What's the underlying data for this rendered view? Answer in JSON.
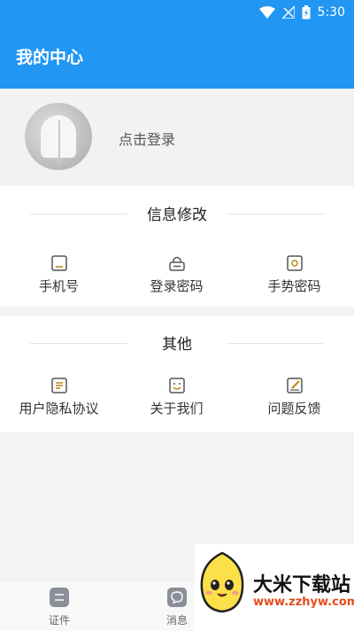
{
  "status_bar": {
    "time": "5:30"
  },
  "header": {
    "title": "我的中心"
  },
  "profile": {
    "login_label": "点击登录"
  },
  "sections": [
    {
      "title": "信息修改",
      "items": [
        {
          "label": "手机号",
          "icon": "phone-icon"
        },
        {
          "label": "登录密码",
          "icon": "lock-icon"
        },
        {
          "label": "手势密码",
          "icon": "gesture-icon"
        }
      ]
    },
    {
      "title": "其他",
      "items": [
        {
          "label": "用户隐私协议",
          "icon": "document-icon"
        },
        {
          "label": "关于我们",
          "icon": "smile-icon"
        },
        {
          "label": "问题反馈",
          "icon": "edit-icon"
        }
      ]
    }
  ],
  "bottom_nav": [
    {
      "label": "证件",
      "icon": "card-icon"
    },
    {
      "label": "消息",
      "icon": "chat-icon"
    }
  ],
  "watermark": {
    "name": "大米下载站",
    "url": "www.zzhyw.com"
  },
  "colors": {
    "primary": "#2196f3",
    "icon_accent": "#b8860b"
  }
}
